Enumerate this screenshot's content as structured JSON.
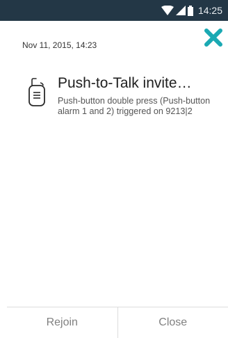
{
  "status_bar": {
    "time": "14:25",
    "icons": [
      "wifi-icon",
      "signal-icon",
      "battery-icon"
    ]
  },
  "header": {
    "timestamp": "Nov 11, 2015, 14:23",
    "close_icon": "close-icon",
    "accent_color": "#1aa9b3"
  },
  "message": {
    "icon": "walkie-talkie-icon",
    "title": "Push-to-Talk invite…",
    "body": "Push-button double press (Push-button alarm 1 and 2) triggered on 9213|2"
  },
  "footer": {
    "rejoin_label": "Rejoin",
    "close_label": "Close"
  }
}
